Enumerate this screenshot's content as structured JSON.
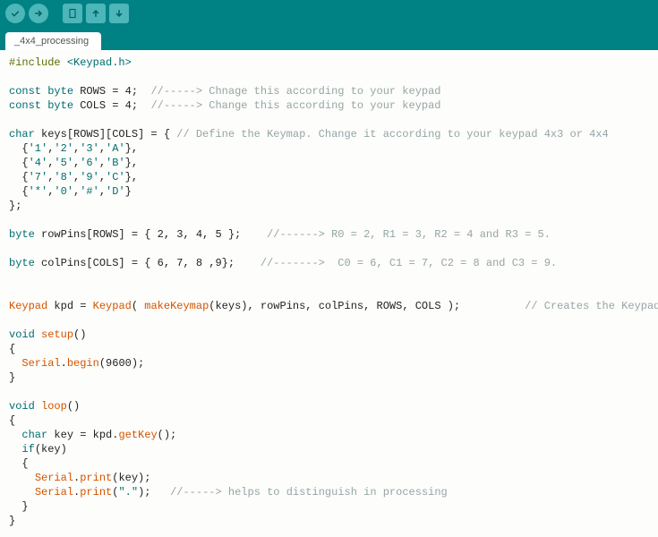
{
  "toolbar": {
    "verify": "Verify",
    "upload": "Upload",
    "new": "New",
    "open": "Open",
    "save": "Save"
  },
  "tabs": [
    {
      "label": "_4x4_processing"
    }
  ],
  "code": {
    "l1_include": "#include",
    "l1_header": "<Keypad.h>",
    "l3_const": "const",
    "l3_byte": "byte",
    "l3_rows_decl": " ROWS = 4;  ",
    "l3_cmt": "//-----> Chnage this according to your keypad",
    "l4_const": "const",
    "l4_byte": "byte",
    "l4_cols_decl": " COLS = 4;  ",
    "l4_cmt": "//-----> Change this according to your keypad",
    "l6_char": "char",
    "l6_rest": " keys[ROWS][COLS] = { ",
    "l6_cmt": "// Define the Keymap. Change it according to your keypad 4x3 or 4x4",
    "l7_lead": "  {",
    "l7_a": "'1'",
    "l7_b": "'2'",
    "l7_c": "'3'",
    "l7_d": "'A'",
    "l7_tail": "},",
    "l8_lead": "  {",
    "l8_a": "'4'",
    "l8_b": "'5'",
    "l8_c": "'6'",
    "l8_d": "'B'",
    "l8_tail": "},",
    "l9_lead": "  {",
    "l9_a": "'7'",
    "l9_b": "'8'",
    "l9_c": "'9'",
    "l9_d": "'C'",
    "l9_tail": "},",
    "l10_lead": "  {",
    "l10_a": "'*'",
    "l10_b": "'0'",
    "l10_c": "'#'",
    "l10_d": "'D'",
    "l10_tail": "}",
    "l11": "};",
    "l13_byte": "byte",
    "l13_rest": " rowPins[ROWS] = { 2, 3, 4, 5 };    ",
    "l13_cmt": "//------> R0 = 2, R1 = 3, R2 = 4 and R3 = 5.",
    "l15_byte": "byte",
    "l15_rest": " colPins[COLS] = { 6, 7, 8 ,9};    ",
    "l15_cmt": "//------->  C0 = 6, C1 = 7, C2 = 8 and C3 = 9.",
    "l18_keypad1": "Keypad",
    "l18_mid1": " kpd = ",
    "l18_keypad2": "Keypad",
    "l18_open": "( ",
    "l18_make": "makeKeymap",
    "l18_args": "(keys), rowPins, colPins, ROWS, COLS );          ",
    "l18_cmt": "// Creates the Keypad",
    "l20_void": "void",
    "l20_name": " setup",
    "l20_paren": "()",
    "l21": "{",
    "l22_lead": "  ",
    "l22_serial": "Serial",
    "l22_dot": ".",
    "l22_begin": "begin",
    "l22_arg": "(9600);",
    "l23": "}",
    "l25_void": "void",
    "l25_name": " loop",
    "l25_paren": "()",
    "l26": "{",
    "l27_lead": "  ",
    "l27_char": "char",
    "l27_mid": " key = kpd.",
    "l27_get": "getKey",
    "l27_end": "();",
    "l28_lead": "  ",
    "l28_if": "if",
    "l28_cond": "(key)",
    "l29": "  {",
    "l30_lead": "    ",
    "l30_serial": "Serial",
    "l30_dot": ".",
    "l30_print": "print",
    "l30_arg": "(key);",
    "l31_lead": "    ",
    "l31_serial": "Serial",
    "l31_dot": ".",
    "l31_print": "print",
    "l31_open": "(",
    "l31_str": "\".\"",
    "l31_close": ");   ",
    "l31_cmt": "//-----> helps to distinguish in processing",
    "l32": "  }",
    "l33": "}"
  }
}
